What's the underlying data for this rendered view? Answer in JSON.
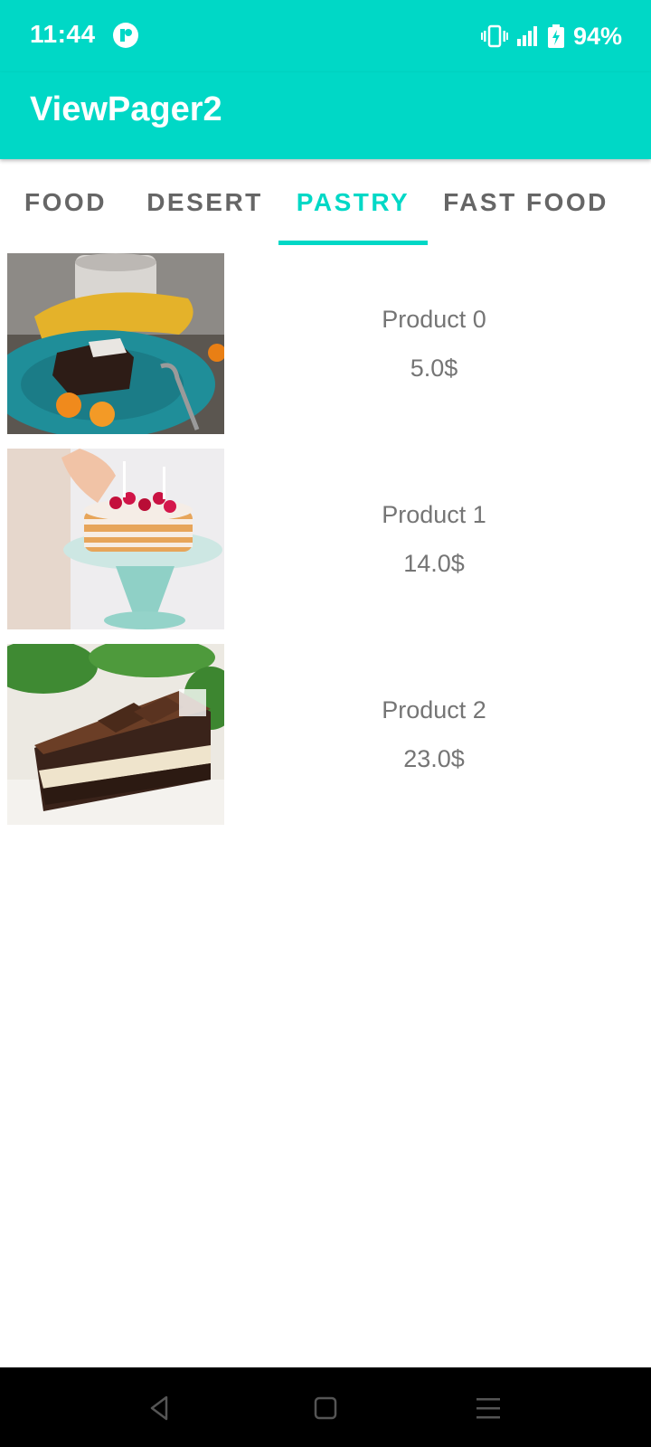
{
  "status_bar": {
    "time": "11:44",
    "battery_percent": "94%",
    "icons": [
      "app-notification-icon",
      "vibrate-icon",
      "signal-icon",
      "battery-charging-icon"
    ]
  },
  "app_bar": {
    "title": "ViewPager2"
  },
  "tabs": [
    {
      "label": "FOOD",
      "active": false
    },
    {
      "label": "DESERT",
      "active": false
    },
    {
      "label": "PASTRY",
      "active": true
    },
    {
      "label": "FAST FOOD",
      "active": false
    }
  ],
  "products": [
    {
      "name": "Product 0",
      "price": "5.0$",
      "image": "brownie-plate-image"
    },
    {
      "name": "Product 1",
      "price": "14.0$",
      "image": "layer-cake-image"
    },
    {
      "name": "Product 2",
      "price": "23.0$",
      "image": "chocolate-cake-slice-image"
    }
  ],
  "nav_bar": {
    "icons": [
      "back-icon",
      "home-icon",
      "recents-icon"
    ]
  },
  "colors": {
    "accent": "#00D8C6",
    "tab_inactive": "#666666",
    "item_text": "#757575"
  }
}
